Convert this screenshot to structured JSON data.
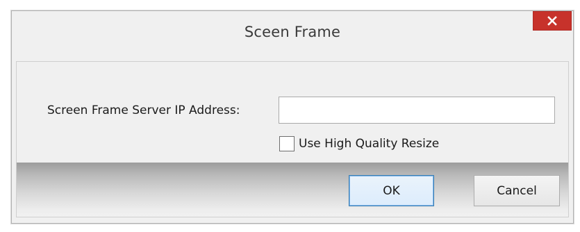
{
  "window": {
    "title": "Sceen Frame",
    "close_glyph": "×"
  },
  "form": {
    "ip_label": "Screen Frame Server IP Address:",
    "ip_value": "",
    "ip_placeholder": "",
    "high_quality_label": "Use High Quality Resize",
    "high_quality_checked": false
  },
  "buttons": {
    "ok_label": "OK",
    "cancel_label": "Cancel"
  },
  "colors": {
    "close_button_bg": "#c7322b",
    "ok_border": "#3c7fb1",
    "dialog_bg": "#f0f0f0"
  },
  "icons": {
    "close": "close-icon",
    "checkbox": "checkbox-unchecked-icon"
  }
}
